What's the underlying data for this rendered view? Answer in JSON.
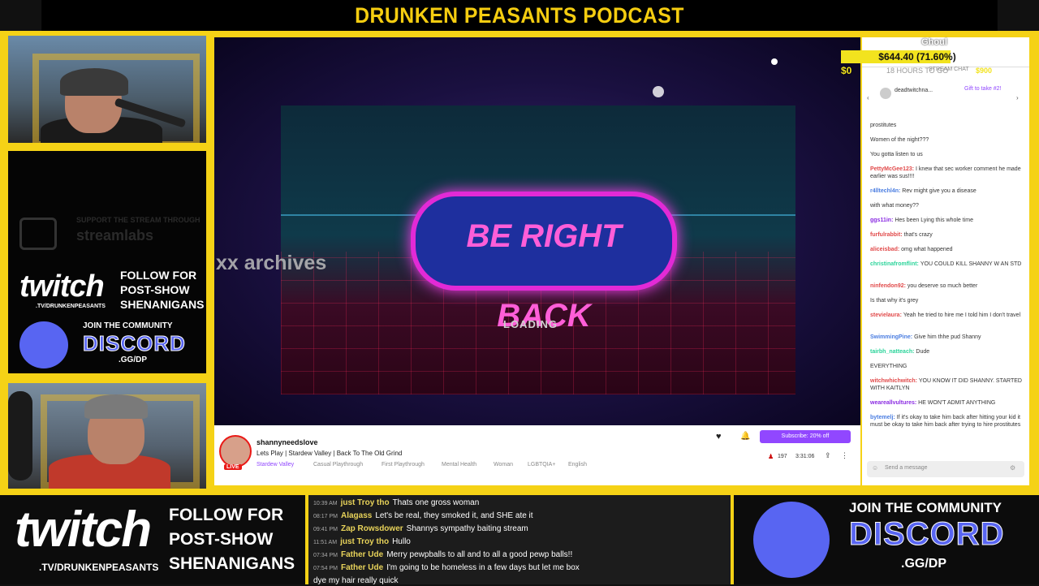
{
  "header": {
    "title": "DRUNKEN PEASANTS PODCAST"
  },
  "left_panel": {
    "twitch_logo": "twitch",
    "twitch_url": ".TV/DRUNKENPEASANTS",
    "follow_text": "FOLLOW FOR POST-SHOW SHENANIGANS",
    "join_text": "JOIN THE COMMUNITY",
    "discord_word": "DISCORD",
    "discord_url": ".GG/DP"
  },
  "stream": {
    "brb_text": "BE RIGHT BACK",
    "loading": "LOADING",
    "overlay_text": "xx archives"
  },
  "stream_info": {
    "channel": "shannyneedslove",
    "title": "Lets Play | Stardew Valley | Back To The Old Grind",
    "game": "Stardew Valley",
    "tags": [
      "Casual Playthrough",
      "First Playthrough",
      "Mental Health",
      "Woman",
      "LGBTQIA+",
      "English"
    ],
    "live_badge": "LIVE",
    "subscribe_label": "Subscribe: 20% off",
    "viewers": "197",
    "uptime": "3:31:06"
  },
  "donation": {
    "name": "Ghoul",
    "amount": "$644.40 (71.60%)",
    "min": "$0",
    "max": "$900",
    "time_left": "18 HOURS TO GO",
    "stream_chat_label": "STREAM CHAT"
  },
  "chat": {
    "gift_user": "deadtwitchna...",
    "gift_label": "Gift to take #2!",
    "messages": [
      {
        "user": "",
        "text": "prostitutes",
        "color": "#2bd49a"
      },
      {
        "user": "",
        "text": "Women of the night???",
        "color": "#2bd49a"
      },
      {
        "user": "",
        "text": "You gotta listen to us",
        "color": "#e14a4a"
      },
      {
        "user": "PettyMcGee123:",
        "text": "I knew that sec worker comment he made earlier was sus!!!!",
        "color": "#e14a4a"
      },
      {
        "user": "r4lltechl4n:",
        "text": "Rev might give you a disease",
        "color": "#4a7de1"
      },
      {
        "user": "",
        "text": "with what money??",
        "color": "#2bd49a"
      },
      {
        "user": "ggs11in:",
        "text": "Hes been Lying this whole time",
        "color": "#8a2be2"
      },
      {
        "user": "furfulrabbit:",
        "text": "that's crazy",
        "color": "#e14a4a"
      },
      {
        "user": "aliceisbad:",
        "text": "omg what happened",
        "color": "#e14a4a"
      },
      {
        "user": "christinafromflint:",
        "text": "YOU COULD KILL SHANNY W AN STD",
        "color": "#2bd49a"
      },
      {
        "user": "ninfendon92:",
        "text": "you deserve so much better",
        "color": "#e14a4a"
      },
      {
        "user": "",
        "text": "Is that why it's grey",
        "color": "#2bd49a"
      },
      {
        "user": "stevielaura:",
        "text": "Yeah he tried to hire me I told him I don't travel",
        "color": "#e14a4a"
      },
      {
        "user": "SwimmingPine:",
        "text": "Give him thhe pud Shanny",
        "color": "#4a7de1"
      },
      {
        "user": "tairbh_natteach:",
        "text": "Dude",
        "color": "#2bd49a"
      },
      {
        "user": "",
        "text": "EVERYTHING",
        "color": "#2bd49a"
      },
      {
        "user": "witchwhichwitch:",
        "text": "YOU KNOW IT DID SHANNY. STARTED WITH KAITLYN",
        "color": "#e14a4a"
      },
      {
        "user": "weareallvultures:",
        "text": "HE WON'T ADMIT ANYTHING",
        "color": "#8a2be2"
      },
      {
        "user": "bytemelj:",
        "text": "If it's okay to take him back after hitting your kid it must be okay to take him back after trying to hire prostitutes",
        "color": "#4a7de1"
      }
    ],
    "input_placeholder": "Send a message"
  },
  "bottom": {
    "twitch_url": ".TV/DRUNKENPEASANTS",
    "follow_text": "FOLLOW FOR POST-SHOW SHENANIGANS",
    "join_text": "JOIN THE COMMUNITY",
    "discord_word": "DISCORD",
    "discord_url": ".GG/DP",
    "chat": [
      {
        "time": "10:39 AM",
        "user": "just Troy tho",
        "text": "Thats one gross woman"
      },
      {
        "time": "08:17 PM",
        "user": "Alagass",
        "text": "Let's be real, they smoked it, and SHE ate it"
      },
      {
        "time": "09:41 PM",
        "user": "Zap Rowsdower",
        "text": "Shannys sympathy baiting stream"
      },
      {
        "time": "11:51 AM",
        "user": "just Troy tho",
        "text": "Hullo"
      },
      {
        "time": "07:34 PM",
        "user": "Father Ude",
        "text": "Merry pewpballs to all and to all a good pewp balls!!"
      },
      {
        "time": "07:54 PM",
        "user": "Father Ude",
        "text": "I'm going to be homeless in a few days but let me box"
      },
      {
        "time": "",
        "user": "",
        "text": "dye my hair really quick"
      }
    ]
  }
}
